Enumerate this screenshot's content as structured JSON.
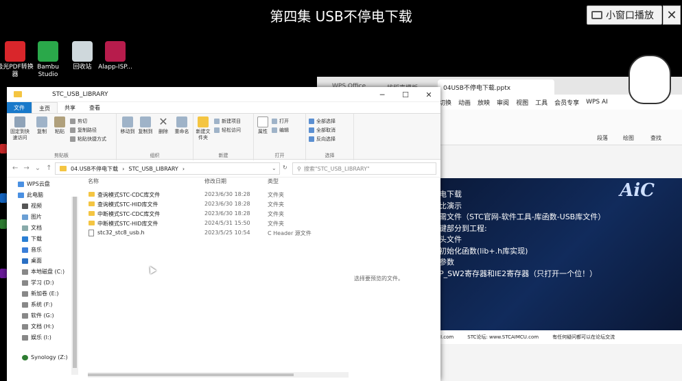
{
  "video": {
    "title": "第四集 USB不停电下载",
    "mini_play_label": "小窗口播放",
    "close_label": "✕"
  },
  "desktop": {
    "icons": [
      {
        "label": "极光PDF转换器",
        "color": "#d9262b"
      },
      {
        "label": "Bambu Studio",
        "color": "#2aa84a"
      },
      {
        "label": "回收站",
        "color": "#cfd8dc"
      },
      {
        "label": "Alapp-ISP...",
        "color": "#b71c4c"
      }
    ]
  },
  "ppt": {
    "tabs": [
      "WPS Office",
      "找稻壳模板",
      "04USB不停电下载.pptx"
    ],
    "menu": [
      "切换",
      "动画",
      "放映",
      "审阅",
      "视图",
      "工具",
      "会员专享",
      "WPS AI"
    ],
    "ribbon_labels": [
      "段落",
      "绘图",
      "查找"
    ],
    "slide_lines": [
      "电下载",
      "比演示",
      "需文件（STC官网-软件工具-库函数-USB库文件）",
      "键部分到工程:",
      "头文件",
      "初始化函数(lib+.h库实现)",
      "参数",
      "P_SW2寄存器和IE2寄存器（只打开一个位！）"
    ],
    "slide_logo": "AiC",
    "footer": [
      "I.com",
      "STC论坛: www.STCAIMCU.com",
      "有任何疑问都可以在论坛交流"
    ]
  },
  "explorer": {
    "title": "STC_USB_LIBRARY",
    "ribbon_tabs": [
      "文件",
      "主页",
      "共享",
      "查看"
    ],
    "groups": {
      "clipboard": {
        "label": "剪贴板",
        "pin": "固定到快速访问",
        "copy": "复制",
        "paste": "粘贴",
        "cut": "剪切",
        "copy_path": "复制路径",
        "paste_shortcut": "粘贴快捷方式"
      },
      "organize": {
        "label": "组织",
        "move_to": "移动到",
        "copy_to": "复制到",
        "delete": "删除",
        "rename": "重命名"
      },
      "new": {
        "label": "新建",
        "new_folder": "新建文件夹",
        "new_item": "新建项目",
        "easy_access": "轻松访问"
      },
      "open": {
        "label": "打开",
        "properties": "属性",
        "open": "打开",
        "edit": "编辑"
      },
      "select": {
        "label": "选择",
        "select_all": "全部选择",
        "select_none": "全部取消",
        "invert": "反向选择"
      }
    },
    "address": {
      "segments": [
        "04.USB不停电下载",
        "STC_USB_LIBRARY"
      ],
      "search_placeholder": "搜索\"STC_USB_LIBRARY\""
    },
    "nav": [
      "WPS云盘",
      "此电脑",
      "视频",
      "图片",
      "文档",
      "下载",
      "音乐",
      "桌面",
      "本地磁盘 (C:)",
      "学习 (D:)",
      "新加卷 (E:)",
      "系统 (F:)",
      "软件 (G:)",
      "文档 (H:)",
      "娱乐 (I:)",
      "Synology (Z:)"
    ],
    "columns": {
      "name": "名称",
      "date": "修改日期",
      "type": "类型"
    },
    "files": [
      {
        "name": "查询模式STC-CDC库文件",
        "date": "2023/6/30 18:28",
        "type": "文件夹",
        "kind": "folder"
      },
      {
        "name": "查询模式STC-HID库文件",
        "date": "2023/6/30 18:28",
        "type": "文件夹",
        "kind": "folder"
      },
      {
        "name": "中断模式STC-CDC库文件",
        "date": "2023/6/30 18:28",
        "type": "文件夹",
        "kind": "folder"
      },
      {
        "name": "中断模式STC-HID库文件",
        "date": "2024/5/31 15:50",
        "type": "文件夹",
        "kind": "folder"
      },
      {
        "name": "stc32_stc8_usb.h",
        "date": "2023/5/25 10:54",
        "type": "C Header 源文件",
        "kind": "header"
      }
    ],
    "preview_tip": "选择要预览的文件。"
  }
}
